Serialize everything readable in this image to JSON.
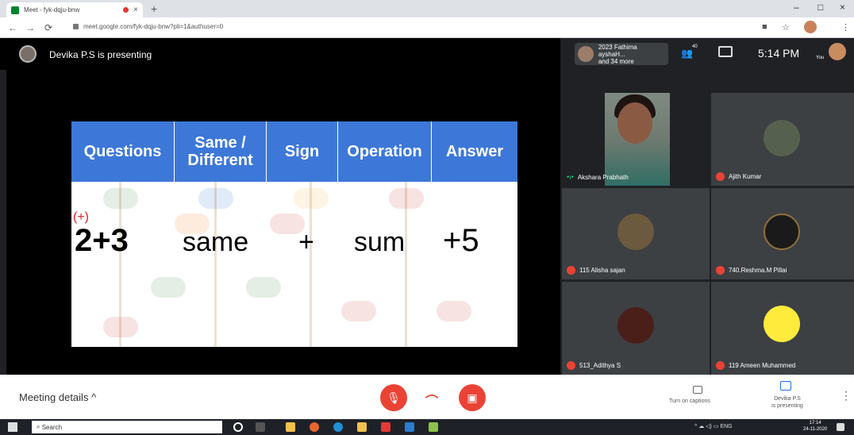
{
  "browser": {
    "tab_title": "Meet - fyk-dqju-bnw",
    "tab_close": "×",
    "new_tab": "+",
    "url": "meet.google.com/fyk-dqju-bnw?pli=1&authuser=0",
    "win_min": "–",
    "win_max": "□",
    "win_close": "×"
  },
  "meet": {
    "presenter_text": "Devika P.S is presenting",
    "info_text_line1": "2023 Fathima ayshaH...",
    "info_text_line2": "and 34 more",
    "people_count": "40",
    "clock": "5:14 PM",
    "you_label": "You"
  },
  "slide": {
    "headers": [
      "Questions",
      "Same / Different",
      "Sign",
      "Operation",
      "Answer"
    ],
    "plus_note": "(+)",
    "question": "2+3",
    "same_diff": "same",
    "sign": "+",
    "operation": "sum",
    "answer": "+5"
  },
  "participants": [
    {
      "name": "Akshara Prabhath",
      "mic": "on"
    },
    {
      "name": "Ajith Kumar",
      "mic": "off"
    },
    {
      "name": "115 Alisha sajan",
      "mic": "off"
    },
    {
      "name": "740.Reshma.M Pillai",
      "mic": "off"
    },
    {
      "name": "513_Adithya S",
      "mic": "off"
    },
    {
      "name": "119 Ameen Muhammed",
      "mic": "off"
    }
  ],
  "controls": {
    "meeting_details": "Meeting details",
    "chevron": "^",
    "captions": "Turn on captions",
    "presenting_line1": "Devika P.S",
    "presenting_line2": "is presenting",
    "more": "⋮"
  },
  "taskbar": {
    "search": "Search",
    "lang": "ENG",
    "time": "17:14",
    "date": "24-11-2020"
  },
  "colors": {
    "slide_header": "#3d78d8",
    "mic_off": "#ea4335",
    "meet_bg": "#202124"
  }
}
